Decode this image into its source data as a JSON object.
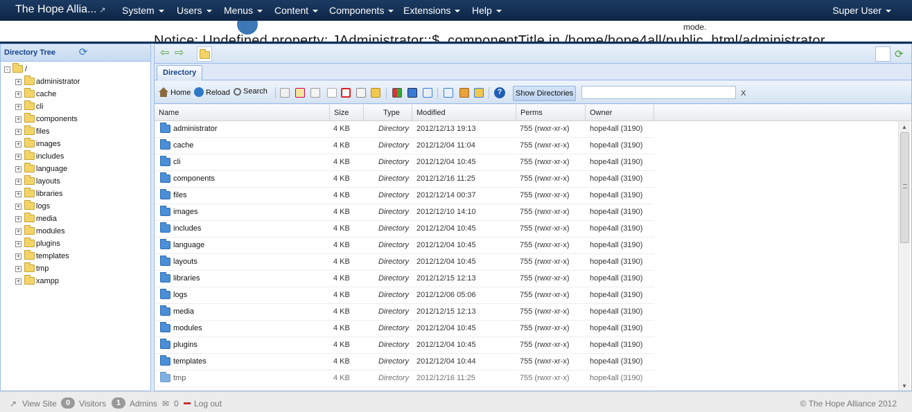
{
  "nav": {
    "brand": "The Hope Allia...",
    "menus": [
      "System",
      "Users",
      "Menus",
      "Content",
      "Components",
      "Extensions",
      "Help"
    ],
    "user": "Super User"
  },
  "header": {
    "notice": "Notice: Undefined property: JAdministrator::$_componentTitle in /home/hope4all/public_html/administrator",
    "mode_text": "mode."
  },
  "tree": {
    "title": "Directory Tree",
    "root": "/",
    "items": [
      "administrator",
      "cache",
      "cli",
      "components",
      "files",
      "images",
      "includes",
      "language",
      "layouts",
      "libraries",
      "logs",
      "media",
      "modules",
      "plugins",
      "templates",
      "tmp",
      "xampp"
    ]
  },
  "tabs": {
    "directory": "Directory"
  },
  "toolbar": {
    "home": "Home",
    "reload": "Reload",
    "search": "Search",
    "show_directories": "Show Directories",
    "filter_clear": "X"
  },
  "grid": {
    "columns": [
      "Name",
      "Size",
      "Type",
      "Modified",
      "Perms",
      "Owner"
    ],
    "rows": [
      {
        "name": "administrator",
        "size": "4 KB",
        "type": "Directory",
        "modified": "2012/12/13 19:13",
        "perms": "755 (rwxr-xr-x)",
        "owner": "hope4all (3190)"
      },
      {
        "name": "cache",
        "size": "4 KB",
        "type": "Directory",
        "modified": "2012/12/04 11:04",
        "perms": "755 (rwxr-xr-x)",
        "owner": "hope4all (3190)"
      },
      {
        "name": "cli",
        "size": "4 KB",
        "type": "Directory",
        "modified": "2012/12/04 10:45",
        "perms": "755 (rwxr-xr-x)",
        "owner": "hope4all (3190)"
      },
      {
        "name": "components",
        "size": "4 KB",
        "type": "Directory",
        "modified": "2012/12/16 11:25",
        "perms": "755 (rwxr-xr-x)",
        "owner": "hope4all (3190)"
      },
      {
        "name": "files",
        "size": "4 KB",
        "type": "Directory",
        "modified": "2012/12/14 00:37",
        "perms": "755 (rwxr-xr-x)",
        "owner": "hope4all (3190)"
      },
      {
        "name": "images",
        "size": "4 KB",
        "type": "Directory",
        "modified": "2012/12/10 14:10",
        "perms": "755 (rwxr-xr-x)",
        "owner": "hope4all (3190)"
      },
      {
        "name": "includes",
        "size": "4 KB",
        "type": "Directory",
        "modified": "2012/12/04 10:45",
        "perms": "755 (rwxr-xr-x)",
        "owner": "hope4all (3190)"
      },
      {
        "name": "language",
        "size": "4 KB",
        "type": "Directory",
        "modified": "2012/12/04 10:45",
        "perms": "755 (rwxr-xr-x)",
        "owner": "hope4all (3190)"
      },
      {
        "name": "layouts",
        "size": "4 KB",
        "type": "Directory",
        "modified": "2012/12/04 10:45",
        "perms": "755 (rwxr-xr-x)",
        "owner": "hope4all (3190)"
      },
      {
        "name": "libraries",
        "size": "4 KB",
        "type": "Directory",
        "modified": "2012/12/15 12:13",
        "perms": "755 (rwxr-xr-x)",
        "owner": "hope4all (3190)"
      },
      {
        "name": "logs",
        "size": "4 KB",
        "type": "Directory",
        "modified": "2012/12/06 05:06",
        "perms": "755 (rwxr-xr-x)",
        "owner": "hope4all (3190)"
      },
      {
        "name": "media",
        "size": "4 KB",
        "type": "Directory",
        "modified": "2012/12/15 12:13",
        "perms": "755 (rwxr-xr-x)",
        "owner": "hope4all (3190)"
      },
      {
        "name": "modules",
        "size": "4 KB",
        "type": "Directory",
        "modified": "2012/12/04 10:45",
        "perms": "755 (rwxr-xr-x)",
        "owner": "hope4all (3190)"
      },
      {
        "name": "plugins",
        "size": "4 KB",
        "type": "Directory",
        "modified": "2012/12/04 10:45",
        "perms": "755 (rwxr-xr-x)",
        "owner": "hope4all (3190)"
      },
      {
        "name": "templates",
        "size": "4 KB",
        "type": "Directory",
        "modified": "2012/12/04 10:44",
        "perms": "755 (rwxr-xr-x)",
        "owner": "hope4all (3190)"
      },
      {
        "name": "tmp",
        "size": "4 KB",
        "type": "Directory",
        "modified": "2012/12/16 11:25",
        "perms": "755 (rwxr-xr-x)",
        "owner": "hope4all (3190)"
      }
    ]
  },
  "footer": {
    "view_site": "View Site",
    "visitors_count": "0",
    "visitors_label": "Visitors",
    "admins_count": "1",
    "admins_label": "Admins",
    "messages_count": "0",
    "logout": "Log out",
    "copyright": "© The Hope Alliance 2012"
  },
  "icons": {
    "brand_external": "external-link-icon",
    "tree_refresh": "refresh-icon",
    "back": "arrow-left-icon",
    "forward": "arrow-right-icon",
    "path_refresh": "refresh-icon",
    "dir": "folder-icon"
  },
  "colors": {
    "navbar": "#0e2646",
    "panel_border": "#99bbe8",
    "dir_icon": "#4a8fd8",
    "tree_folder": "#f3d469"
  }
}
